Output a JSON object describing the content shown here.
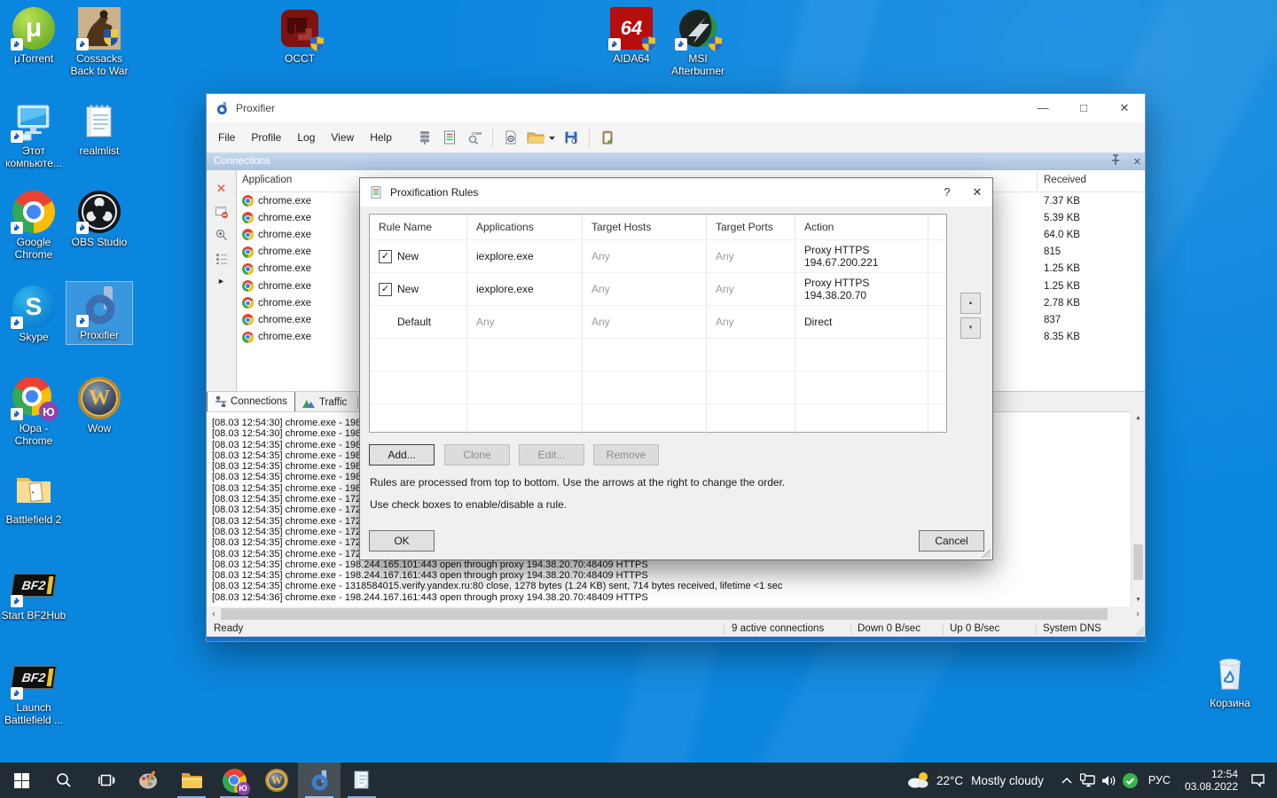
{
  "desktop": {
    "icons": [
      {
        "label": "μTorrent"
      },
      {
        "label": "Cossacks Back to War"
      },
      {
        "label": "OCCT"
      },
      {
        "label": "AIDA64"
      },
      {
        "label": "MSI Afterburner"
      },
      {
        "label": "Этот компьюте..."
      },
      {
        "label": "realmlist"
      },
      {
        "label": "Google Chrome"
      },
      {
        "label": "OBS Studio"
      },
      {
        "label": "Skype"
      },
      {
        "label": "Proxifier"
      },
      {
        "label": "Юра - Chrome"
      },
      {
        "label": "Wow"
      },
      {
        "label": "Battlefield 2"
      },
      {
        "label": "Start BF2Hub"
      },
      {
        "label": "Launch Battlefield ..."
      },
      {
        "label": "Корзина"
      }
    ],
    "logo_text": {
      "utorrent": "μ",
      "skype": "S",
      "aida": "64",
      "wow": "W",
      "yu_badge": "Ю",
      "bf2": "BF2"
    }
  },
  "window": {
    "title": "Proxifier",
    "menu": [
      "File",
      "Profile",
      "Log",
      "View",
      "Help"
    ],
    "panel_caption": "Connections",
    "list": {
      "col_application": "Application",
      "col_received": "Received",
      "rows": [
        {
          "app": "chrome.exe",
          "received": "7.37 KB"
        },
        {
          "app": "chrome.exe",
          "received": "5.39 KB"
        },
        {
          "app": "chrome.exe",
          "received": "64.0 KB"
        },
        {
          "app": "chrome.exe",
          "received": "815"
        },
        {
          "app": "chrome.exe",
          "received": "1.25 KB"
        },
        {
          "app": "chrome.exe",
          "received": "1.25 KB"
        },
        {
          "app": "chrome.exe",
          "received": "2.78 KB"
        },
        {
          "app": "chrome.exe",
          "received": "837"
        },
        {
          "app": "chrome.exe",
          "received": "8.35 KB"
        }
      ]
    },
    "tabs": {
      "connections": "Connections",
      "traffic": "Traffic"
    },
    "log_lines": [
      "[08.03 12:54:30] chrome.exe - 198.244.",
      "[08.03 12:54:30] chrome.exe - 198.244.",
      "[08.03 12:54:35] chrome.exe - 198.244.",
      "[08.03 12:54:35] chrome.exe - 198.244.",
      "[08.03 12:54:35] chrome.exe - 198.244.",
      "[08.03 12:54:35] chrome.exe - 198.244.",
      "[08.03 12:54:35] chrome.exe - 198.244.",
      "[08.03 12:54:35] chrome.exe - 172.67.1",
      "[08.03 12:54:35] chrome.exe - 172.67.1",
      "[08.03 12:54:35] chrome.exe - 172.67.1",
      "[08.03 12:54:35] chrome.exe - 172.67.1",
      "[08.03 12:54:35] chrome.exe - 172.67.1",
      "[08.03 12:54:35] chrome.exe - 172.67.1",
      "[08.03 12:54:35] chrome.exe - 198.244.165.101:443 open through proxy 194.38.20.70:48409 HTTPS",
      "[08.03 12:54:35] chrome.exe - 198.244.167.161:443 open through proxy 194.38.20.70:48409 HTTPS",
      "[08.03 12:54:35] chrome.exe - 1318584015.verify.yandex.ru:80 close, 1278 bytes (1.24 KB) sent, 714 bytes received, lifetime <1 sec",
      "[08.03 12:54:36] chrome.exe - 198.244.167.161:443 open through proxy 194.38.20.70:48409 HTTPS"
    ],
    "status": {
      "ready": "Ready",
      "active": "9 active connections",
      "down": "Down 0 B/sec",
      "up": "Up 0 B/sec",
      "dns": "System DNS"
    }
  },
  "dialog": {
    "title": "Proxification Rules",
    "columns": [
      "Rule Name",
      "Applications",
      "Target Hosts",
      "Target Ports",
      "Action"
    ],
    "rules": [
      {
        "checked": true,
        "name": "New",
        "apps": "iexplore.exe",
        "hosts": "Any",
        "ports": "Any",
        "action1": "Proxy HTTPS",
        "action2": "194.67.200.221"
      },
      {
        "checked": true,
        "name": "New",
        "apps": "iexplore.exe",
        "hosts": "Any",
        "ports": "Any",
        "action1": "Proxy HTTPS",
        "action2": "194.38.20.70"
      },
      {
        "checked": false,
        "name": "Default",
        "apps": "Any",
        "hosts": "Any",
        "ports": "Any",
        "action1": "Direct",
        "action2": ""
      }
    ],
    "buttons": {
      "add": "Add...",
      "clone": "Clone",
      "edit": "Edit...",
      "remove": "Remove",
      "ok": "OK",
      "cancel": "Cancel"
    },
    "hint_order": "Rules are processed from top to bottom. Use the arrows at the right to change the order.",
    "hint_checkbox": "Use check boxes to enable/disable a rule."
  },
  "taskbar": {
    "weather_temp": "22°C",
    "weather_text": "Mostly cloudy",
    "lang": "РУС",
    "time": "12:54",
    "date": "03.08.2022"
  },
  "glyphs": {
    "minimize": "—",
    "maximize": "□",
    "close": "✕",
    "dialog_help": "?",
    "dialog_close": "✕",
    "panel_close": "✕",
    "left_close": "✕",
    "play": "►",
    "check": "✓",
    "spin_up": "▲",
    "spin_down": "▼",
    "hscroll_left": "‹",
    "hscroll_right": "›",
    "vscroll_up": "▲",
    "vscroll_down": "▼"
  }
}
